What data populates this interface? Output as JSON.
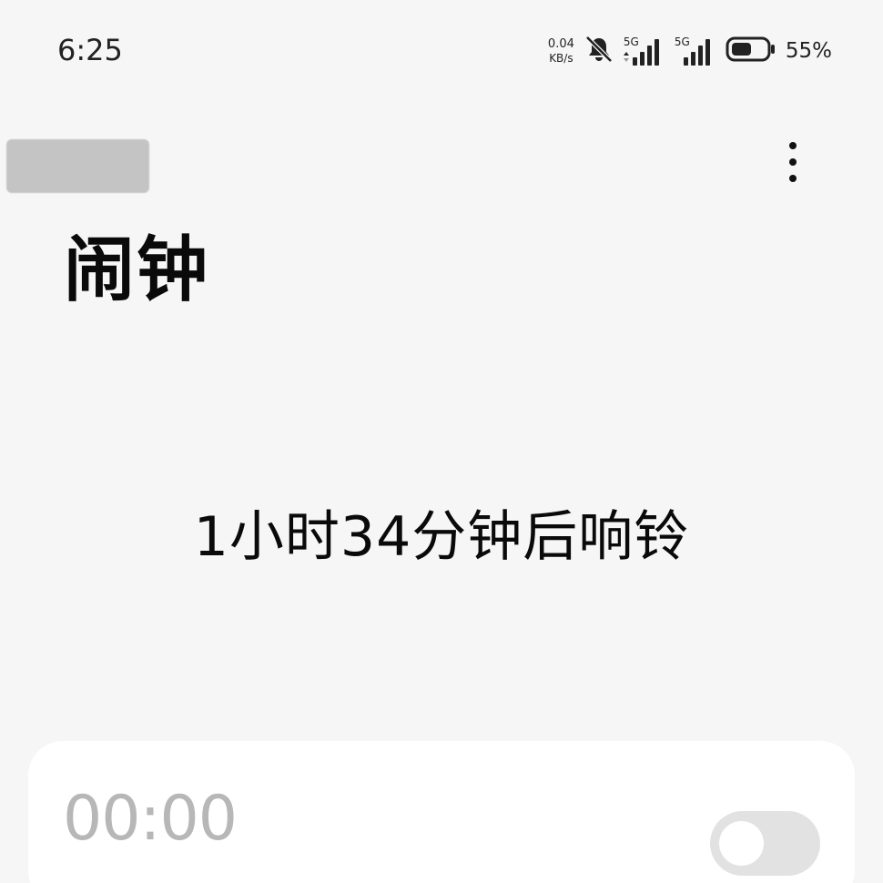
{
  "status_bar": {
    "time": "6:25",
    "net_speed_value": "0.04",
    "net_speed_unit": "KB/s",
    "silent_icon": "bell-off-icon",
    "sim1_label": "5G",
    "sim2_label": "5G",
    "battery_percent": "55%",
    "battery_level": 0.55
  },
  "header": {
    "more_icon": "more-vertical-icon"
  },
  "page": {
    "title": "闹钟",
    "next_alarm_text": "1小时34分钟后响铃"
  },
  "alarms": [
    {
      "time": "00:00",
      "subtitle": "",
      "enabled": false
    }
  ]
}
